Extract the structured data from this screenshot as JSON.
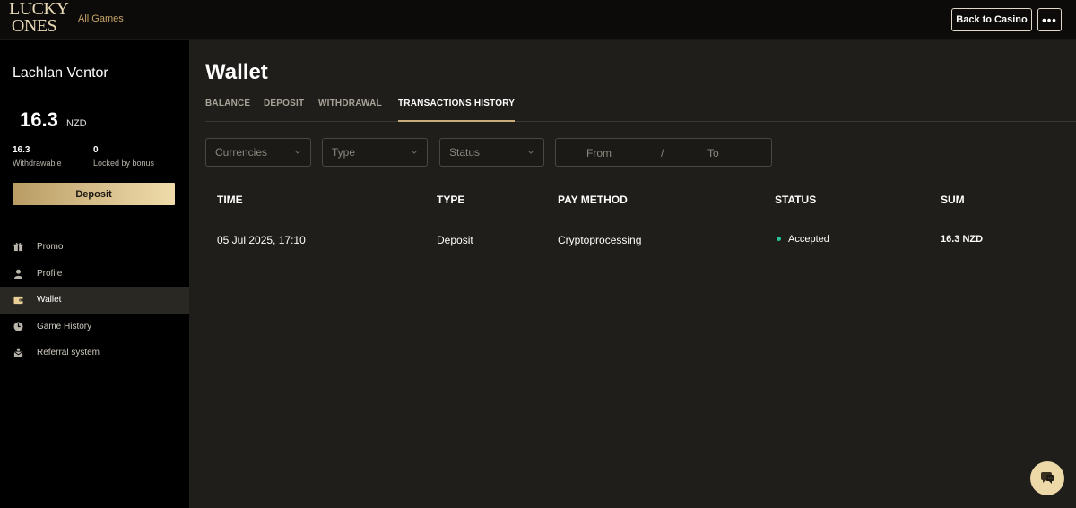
{
  "header": {
    "logo_line1": "LUCKY",
    "logo_line2": "ONES",
    "all_games": "All Games",
    "back_to_casino": "Back to Casino",
    "more": "•••"
  },
  "sidebar": {
    "user_name": "Lachlan Ventor",
    "balance": "16.3",
    "currency": "NZD",
    "withdrawable_value": "16.3",
    "withdrawable_label": "Withdrawable",
    "locked_value": "0",
    "locked_label": "Locked by bonus",
    "deposit_button": "Deposit",
    "nav": [
      {
        "label": "Promo",
        "icon": "gift-icon"
      },
      {
        "label": "Profile",
        "icon": "user-icon"
      },
      {
        "label": "Wallet",
        "icon": "wallet-icon",
        "active": true
      },
      {
        "label": "Game History",
        "icon": "clock-icon"
      },
      {
        "label": "Referral system",
        "icon": "referral-icon"
      }
    ]
  },
  "main": {
    "title": "Wallet",
    "tabs": [
      {
        "label": "BALANCE"
      },
      {
        "label": "DEPOSIT"
      },
      {
        "label": "WITHDRAWAL"
      },
      {
        "label": "TRANSACTIONS HISTORY",
        "active": true
      }
    ],
    "filters": {
      "currencies": "Currencies",
      "type": "Type",
      "status": "Status",
      "from": "From",
      "separator": "/",
      "to": "To"
    },
    "table": {
      "headers": [
        "TIME",
        "TYPE",
        "PAY METHOD",
        "STATUS",
        "SUM"
      ],
      "rows": [
        {
          "time": "05 Jul 2025, 17:10",
          "type": "Deposit",
          "pay_method": "Cryptoprocessing",
          "status": "Accepted",
          "sum": "16.3 NZD"
        }
      ]
    }
  },
  "colors": {
    "accent_gold": "#c9ad78",
    "status_accepted": "#27c39a",
    "main_bg": "#201e1b"
  }
}
